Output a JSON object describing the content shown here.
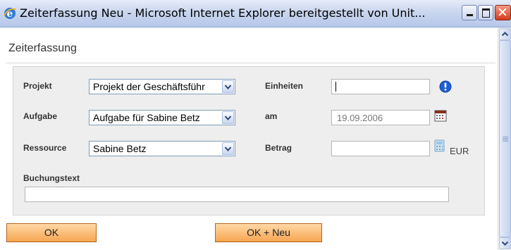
{
  "window": {
    "title": "Zeiterfassung Neu - Microsoft Internet Explorer bereitgestellt von Unit...",
    "icon": "ie-icon",
    "controls": [
      "minimize-icon",
      "maximize-icon",
      "close-icon"
    ]
  },
  "page": {
    "heading": "Zeiterfassung"
  },
  "form": {
    "projekt": {
      "label": "Projekt",
      "value": "Projekt der Geschäftsführ"
    },
    "aufgabe": {
      "label": "Aufgabe",
      "value": "Aufgabe für Sabine Betz"
    },
    "ressource": {
      "label": "Ressource",
      "value": "Sabine Betz"
    },
    "einheiten": {
      "label": "Einheiten",
      "value": ""
    },
    "am": {
      "label": "am",
      "value": "19.09.2006"
    },
    "betrag": {
      "label": "Betrag",
      "value": "",
      "unit": "EUR"
    },
    "buchungstext": {
      "label": "Buchungstext",
      "value": ""
    }
  },
  "buttons": {
    "ok": "OK",
    "ok_neu": "OK + Neu"
  },
  "colors": {
    "button_fill": "#f7a54f",
    "info_icon": "#1f5fd6",
    "titlebar": "#c9d6ef"
  }
}
